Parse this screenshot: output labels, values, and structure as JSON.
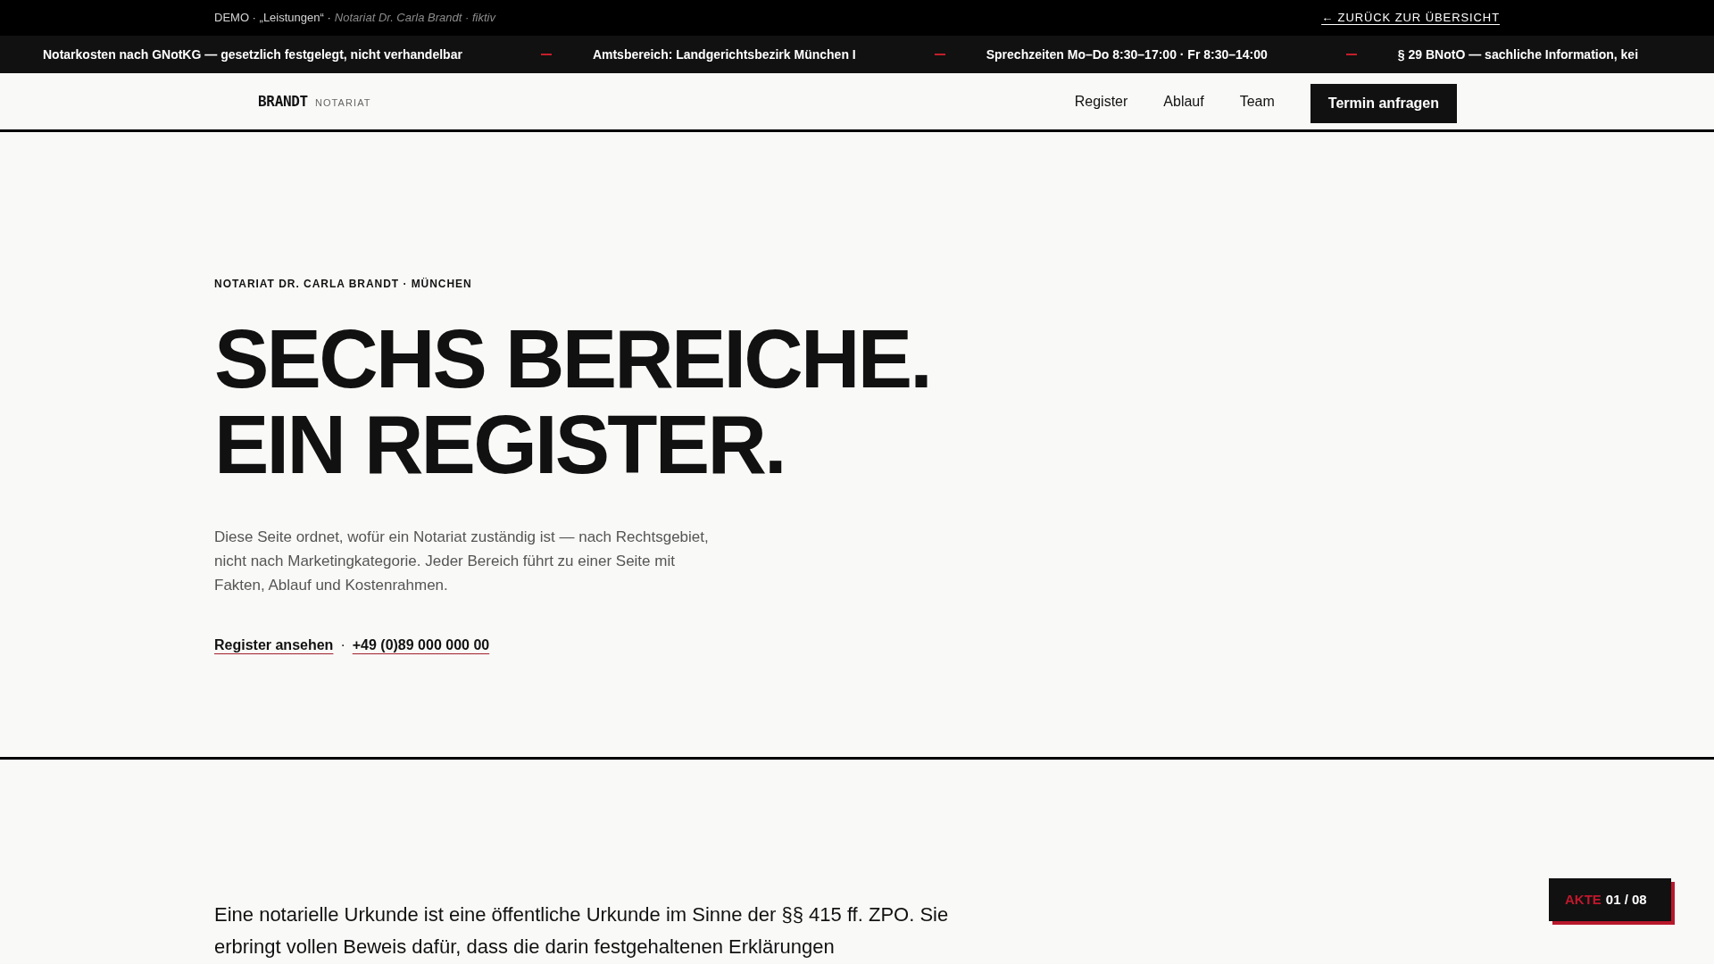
{
  "top_bar": {
    "demo_label": "DEMO · „Leistungen“ ·",
    "note": "Notariat Dr. Carla Brandt · fiktiv",
    "back_link": "← ZURÜCK ZUR ÜBERSICHT"
  },
  "ticker": {
    "items": [
      "Notarkosten nach GNotKG — gesetzlich festgelegt, nicht verhandelbar",
      "Amtsbereich: Landgerichtsbezirk München I",
      "Sprechzeiten Mo–Do 8:30–17:00 · Fr 8:30–14:00",
      "§ 29 BNotO — sachliche Information, kei"
    ]
  },
  "nav": {
    "logo": {
      "name": "BRANDT",
      "suffix": "NOTARIAT"
    },
    "links": [
      "Register",
      "Ablauf",
      "Team"
    ],
    "cta": "Termin anfragen"
  },
  "hero": {
    "eyebrow": "NOTARIAT DR. CARLA BRANDT · MÜNCHEN",
    "headline": [
      "SECHS BEREICHE.",
      "EIN REGISTER."
    ],
    "intro": "Diese Seite ordnet, wofür ein Notariat zuständig ist — nach Rechtsgebiet, nicht nach Marketingkategorie. Jeder Bereich führt zu einer Seite mit Fakten, Ablauf und Kostenrahmen.",
    "links": [
      "Register ansehen",
      "+49 (0)89 000 000 00"
    ],
    "separator": "·"
  },
  "section": {
    "lead": "Eine notarielle Urkunde ist eine öffentliche Urkunde im Sinne der §§ 415 ff. ZPO. Sie erbringt vollen Beweis dafür, dass die darin festgehaltenen Erklärungen"
  },
  "file_counter": {
    "label": "AKTE",
    "value": "01 / 08"
  }
}
